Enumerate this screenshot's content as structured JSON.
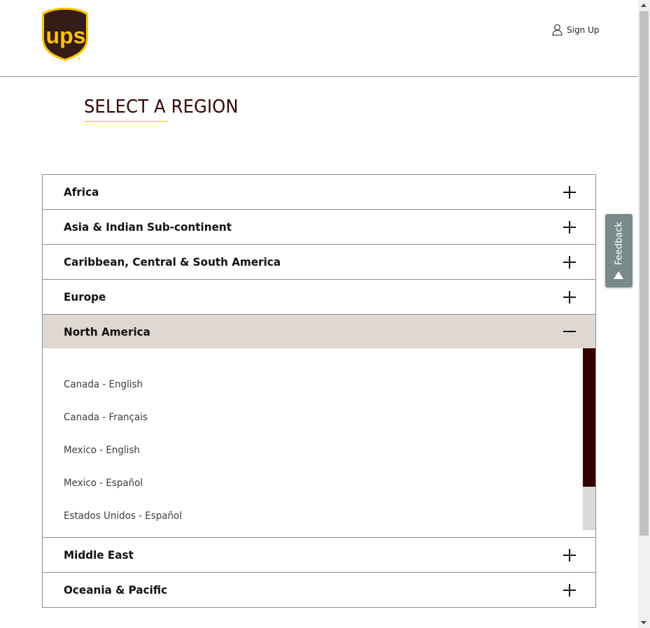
{
  "header": {
    "logo_text": "ups",
    "signup_label": "Sign Up"
  },
  "page_title": "SELECT A REGION",
  "regions": [
    {
      "label": "Africa",
      "expanded": false
    },
    {
      "label": "Asia & Indian Sub-continent",
      "expanded": false
    },
    {
      "label": "Caribbean, Central & South America",
      "expanded": false
    },
    {
      "label": "Europe",
      "expanded": false
    },
    {
      "label": "North America",
      "expanded": true,
      "links": [
        "Canada - English",
        "Canada - Français",
        "Mexico - English",
        "Mexico - Español",
        "Estados Unidos - Español"
      ]
    },
    {
      "label": "Middle East",
      "expanded": false
    },
    {
      "label": "Oceania & Pacific",
      "expanded": false
    }
  ],
  "feedback": {
    "label": "Feedback"
  },
  "icons": {
    "signup": "user-icon",
    "expand": "plus-icon",
    "collapse": "minus-icon",
    "feedback": "triangle-up-icon"
  },
  "colors": {
    "brand_brown": "#350000",
    "brand_gold": "#ffc400",
    "expanded_bg": "#dfd8d2",
    "feedback_bg": "#7a8a8a"
  }
}
